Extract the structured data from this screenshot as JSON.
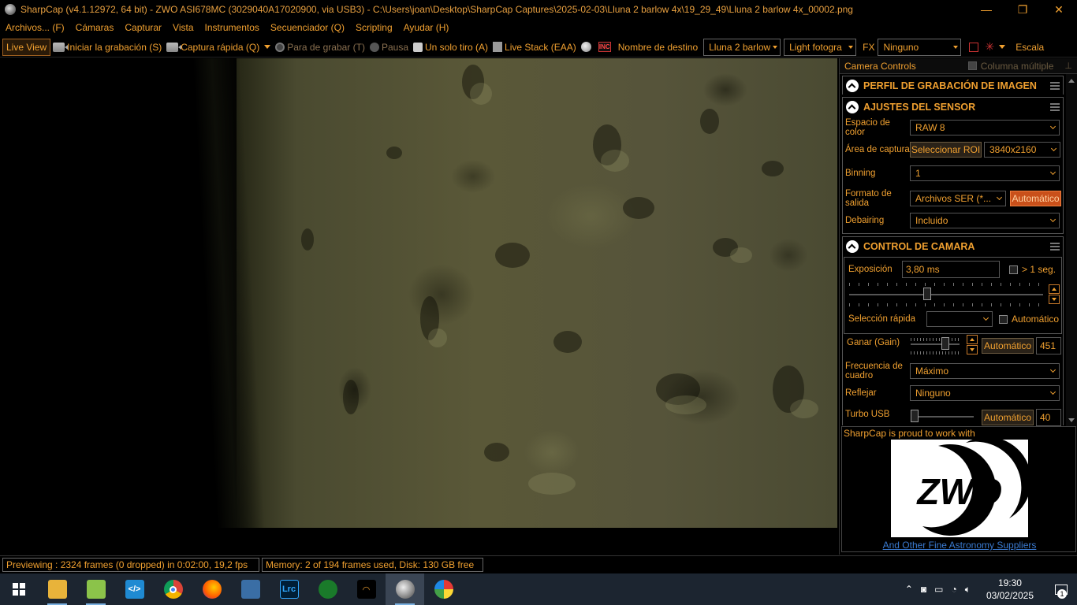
{
  "window": {
    "title": "SharpCap (v4.1.12972, 64 bit) - ZWO ASI678MC (3029040A17020900, via USB3) - C:\\Users\\joan\\Desktop\\SharpCap Captures\\2025-02-03\\Lluna 2 barlow 4x\\19_29_49\\Lluna 2 barlow 4x_00002.png",
    "controls": [
      "—",
      "❐",
      "✕"
    ]
  },
  "menu": [
    "Archivos... (F)",
    "Cámaras",
    "Capturar",
    "Vista",
    "Instrumentos",
    "Secuenciador (Q)",
    "Scripting",
    "Ayudar (H)"
  ],
  "toolbar": {
    "live_view": "Live View",
    "start_capture": "Iniciar la grabación (S)",
    "quick_capture": "Captura rápida (Q)",
    "stop_capture": "Para de grabar (T)",
    "pause": "Pausa",
    "single": "Un solo tiro (A)",
    "live_stack": "Live Stack (EAA)",
    "target_label": "Nombre de destino",
    "target_value": "Lluna 2 barlow",
    "frame_type": "Light fotogra",
    "fx_label": "FX",
    "fx_value": "Ninguno",
    "scale": "Escala"
  },
  "panel": {
    "header": "Camera Controls",
    "multi_column": "Columna múltiple",
    "sections": {
      "profile": "PERFIL DE GRABACIÓN DE IMAGEN",
      "sensor": "AJUSTES DEL SENSOR",
      "camera": "CONTROL DE CAMARA"
    },
    "sensor": {
      "color_space_label": "Espacio de color",
      "color_space": "RAW 8",
      "capture_area_label": "Área de captura",
      "select_roi": "Seleccionar ROI",
      "resolution": "3840x2160",
      "binning_label": "Binning",
      "binning": "1",
      "output_label": "Formato de salida",
      "output": "Archivos SER (*...",
      "auto": "Automático",
      "debayer_label": "Debairing",
      "debayer": "Incluido"
    },
    "camera": {
      "exposure_label": "Exposición",
      "exposure": "3,80 ms",
      "gt1s": "> 1 seg.",
      "exposure_slider_pct": 0.4,
      "quick_select_label": "Selección rápida",
      "quick_auto": "Automático",
      "gain_label": "Ganar (Gain)",
      "gain_auto": "Automático",
      "gain": "451",
      "gain_slider_pct": 0.75,
      "framerate_label": "Frecuencia de cuadro",
      "framerate": "Máximo",
      "flip_label": "Reflejar",
      "flip": "Ninguno",
      "usb_label": "Turbo USB",
      "usb_auto": "Automático",
      "usb": "40",
      "usb_slider_pct": 0.0
    }
  },
  "promo": {
    "text": "SharpCap is proud to work with",
    "logo": "ZWO",
    "link": "And Other Fine Astronomy Suppliers"
  },
  "status": {
    "preview": "Previewing : 2324 frames (0 dropped) in 0:02:00, 19,2 fps",
    "memory": "Memory: 2 of 194 frames used, Disk: 130 GB free"
  },
  "taskbar": {
    "time": "19:30",
    "date": "03/02/2025",
    "notifications": "1",
    "apps": [
      "file-explorer",
      "notepad",
      "vscode",
      "chrome",
      "firefox",
      "network-app",
      "lightroom",
      "app-green",
      "app-orbit",
      "sharpcap",
      "paint"
    ]
  },
  "colors": {
    "accent": "#f0a030",
    "orange_button": "#c9501a",
    "taskbar": "#1c2530"
  }
}
